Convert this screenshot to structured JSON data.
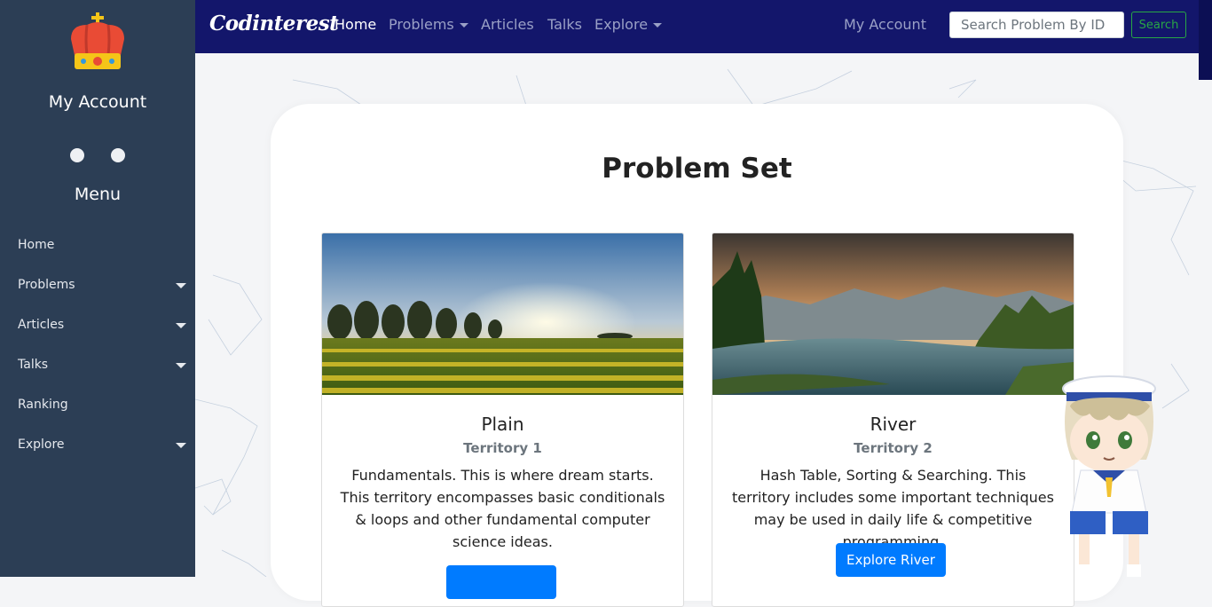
{
  "sidebar": {
    "account_label": "My Account",
    "menu_label": "Menu",
    "items": [
      {
        "label": "Home"
      },
      {
        "label": "Problems"
      },
      {
        "label": "Articles"
      },
      {
        "label": "Talks"
      },
      {
        "label": "Ranking"
      },
      {
        "label": "Explore"
      }
    ]
  },
  "navbar": {
    "brand": "Codinterest",
    "items": [
      {
        "label": "Home"
      },
      {
        "label": "Problems"
      },
      {
        "label": "Articles"
      },
      {
        "label": "Talks"
      },
      {
        "label": "Explore"
      }
    ],
    "account": "My Account",
    "search_placeholder": "Search Problem By ID",
    "search_button": "Search"
  },
  "main": {
    "title": "Problem Set",
    "cards": [
      {
        "title": "Plain",
        "subtitle": "Territory 1",
        "description": "Fundamentals. This is where dream starts. This territory encompasses basic conditionals & loops and other fundamental computer science ideas.",
        "button": ""
      },
      {
        "title": "River",
        "subtitle": "Territory 2",
        "description": "Hash Table, Sorting & Searching. This territory includes some important techniques may be used in daily life & competitive programming.",
        "button": "Explore River"
      }
    ]
  },
  "colors": {
    "sidebar_bg": "#2c3e55",
    "navbar_bg": "#13166b",
    "primary": "#007bff",
    "success": "#28a745"
  }
}
